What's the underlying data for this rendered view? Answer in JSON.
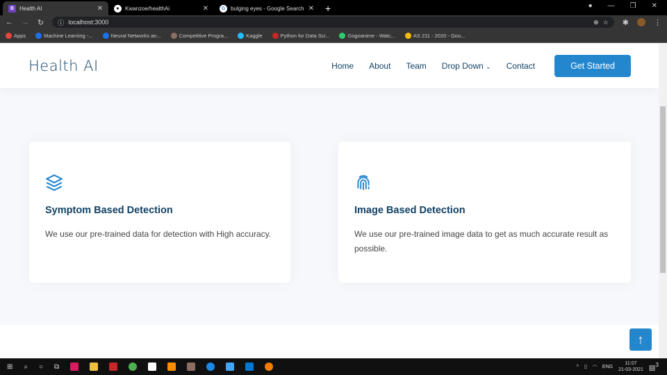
{
  "browser": {
    "tabs": [
      {
        "label": "Health AI",
        "icon": "bootstrap-icon",
        "active": true
      },
      {
        "label": "Kwanzoe/healthAi",
        "icon": "github-icon"
      },
      {
        "label": "bulging eyes - Google Search",
        "icon": "google-icon"
      }
    ],
    "url": "localhost:3000",
    "bookmarks": [
      {
        "label": "Apps",
        "color": "#e8453c"
      },
      {
        "label": "Machine Learning -...",
        "color": "#1a73e8"
      },
      {
        "label": "Neural Networks an...",
        "color": "#1a73e8"
      },
      {
        "label": "Competitive Progra...",
        "color": "#8d6e63"
      },
      {
        "label": "Kaggle",
        "color": "#20beff"
      },
      {
        "label": "Python for Data Sci...",
        "color": "#c62828"
      },
      {
        "label": "Gogoanime - Watc...",
        "color": "#2ecc71"
      },
      {
        "label": "AS 211 - 2020 - Goo...",
        "color": "#fbbc04"
      }
    ]
  },
  "header": {
    "logo": "Health AI",
    "nav": [
      "Home",
      "About",
      "Team",
      "Drop Down",
      "Contact"
    ],
    "cta": "Get Started"
  },
  "cards": [
    {
      "icon": "layers-icon",
      "title": "Symptom Based Detection",
      "text": "We use our pre-trained data for detection with High accuracy."
    },
    {
      "icon": "fingerprint-icon",
      "title": "Image Based Detection",
      "text": "We use our pre-trained image data to get as much accurate result as possible."
    }
  ],
  "colors": {
    "accent": "#2487ce",
    "heading": "#124265"
  },
  "taskbar": {
    "lang": "ENG",
    "time": "11:07",
    "date": "21-03-2021",
    "notifications": "3"
  }
}
